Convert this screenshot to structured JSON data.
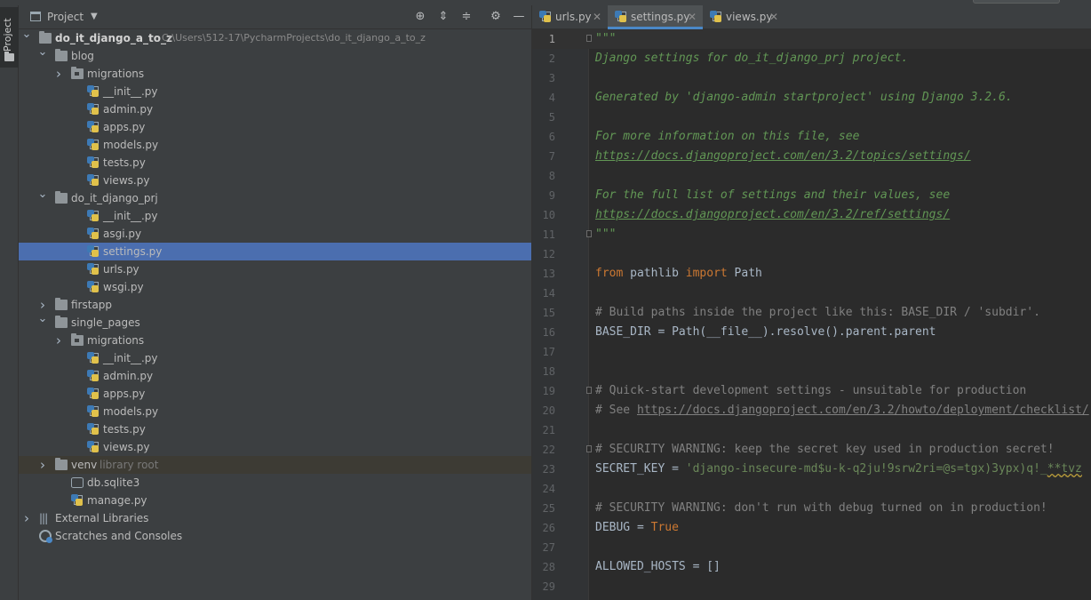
{
  "project_panel": {
    "title": "Project",
    "tool_window_label": "Project",
    "tree": [
      {
        "depth": 0,
        "type": "folder",
        "expanded": true,
        "label": "do_it_django_a_to_z",
        "bold": true,
        "path": "C:\\Users\\512-17\\PycharmProjects\\do_it_django_a_to_z"
      },
      {
        "depth": 1,
        "type": "folder",
        "expanded": true,
        "label": "blog"
      },
      {
        "depth": 2,
        "type": "package",
        "expanded": false,
        "label": "migrations"
      },
      {
        "depth": 2,
        "type": "py",
        "label": "__init__.py"
      },
      {
        "depth": 2,
        "type": "py",
        "label": "admin.py"
      },
      {
        "depth": 2,
        "type": "py",
        "label": "apps.py"
      },
      {
        "depth": 2,
        "type": "py",
        "label": "models.py"
      },
      {
        "depth": 2,
        "type": "py",
        "label": "tests.py"
      },
      {
        "depth": 2,
        "type": "py",
        "label": "views.py"
      },
      {
        "depth": 1,
        "type": "folder",
        "expanded": true,
        "label": "do_it_django_prj"
      },
      {
        "depth": 2,
        "type": "py",
        "label": "__init__.py"
      },
      {
        "depth": 2,
        "type": "py",
        "label": "asgi.py"
      },
      {
        "depth": 2,
        "type": "py",
        "label": "settings.py",
        "selected": true
      },
      {
        "depth": 2,
        "type": "py",
        "label": "urls.py"
      },
      {
        "depth": 2,
        "type": "py",
        "label": "wsgi.py"
      },
      {
        "depth": 1,
        "type": "folder",
        "expanded": false,
        "label": "firstapp"
      },
      {
        "depth": 1,
        "type": "folder",
        "expanded": true,
        "label": "single_pages"
      },
      {
        "depth": 2,
        "type": "package",
        "expanded": false,
        "label": "migrations"
      },
      {
        "depth": 2,
        "type": "py",
        "label": "__init__.py"
      },
      {
        "depth": 2,
        "type": "py",
        "label": "admin.py"
      },
      {
        "depth": 2,
        "type": "py",
        "label": "apps.py"
      },
      {
        "depth": 2,
        "type": "py",
        "label": "models.py"
      },
      {
        "depth": 2,
        "type": "py",
        "label": "tests.py"
      },
      {
        "depth": 2,
        "type": "py",
        "label": "views.py"
      },
      {
        "depth": 1,
        "type": "folder",
        "expanded": false,
        "label": "venv",
        "hint": "library root",
        "excluded": true
      },
      {
        "depth": 1,
        "type": "db",
        "label": "db.sqlite3"
      },
      {
        "depth": 1,
        "type": "py",
        "label": "manage.py"
      },
      {
        "depth": 0,
        "type": "lib",
        "expanded": false,
        "label": "External Libraries"
      },
      {
        "depth": 0,
        "type": "scratch",
        "label": "Scratches and Consoles"
      }
    ]
  },
  "editor": {
    "tabs": [
      {
        "label": "urls.py",
        "active": false
      },
      {
        "label": "settings.py",
        "active": true
      },
      {
        "label": "views.py",
        "active": false
      }
    ],
    "current_line": 1,
    "lines": [
      {
        "n": "1",
        "fold": true,
        "tokens": [
          [
            "doc",
            "\"\"\""
          ]
        ]
      },
      {
        "n": "2",
        "tokens": [
          [
            "doc",
            "Django settings for do_it_django_prj project."
          ]
        ]
      },
      {
        "n": "3",
        "tokens": []
      },
      {
        "n": "4",
        "tokens": [
          [
            "doc",
            "Generated by 'django-admin startproject' using Django 3.2.6."
          ]
        ]
      },
      {
        "n": "5",
        "tokens": []
      },
      {
        "n": "6",
        "tokens": [
          [
            "doc",
            "For more information on this file, see"
          ]
        ]
      },
      {
        "n": "7",
        "tokens": [
          [
            "doclink",
            "https://docs.djangoproject.com/en/3.2/topics/settings/"
          ]
        ]
      },
      {
        "n": "8",
        "tokens": []
      },
      {
        "n": "9",
        "tokens": [
          [
            "doc",
            "For the full list of settings and their values, see"
          ]
        ]
      },
      {
        "n": "10",
        "tokens": [
          [
            "doclink",
            "https://docs.djangoproject.com/en/3.2/ref/settings/"
          ]
        ]
      },
      {
        "n": "11",
        "fold": true,
        "tokens": [
          [
            "doc",
            "\"\"\""
          ]
        ]
      },
      {
        "n": "12",
        "tokens": []
      },
      {
        "n": "13",
        "tokens": [
          [
            "kw",
            "from"
          ],
          [
            "pl",
            " pathlib "
          ],
          [
            "kw",
            "import"
          ],
          [
            "pl",
            " Path"
          ]
        ]
      },
      {
        "n": "14",
        "tokens": []
      },
      {
        "n": "15",
        "tokens": [
          [
            "cm",
            "# Build paths inside the project like this: BASE_DIR / 'subdir'."
          ]
        ]
      },
      {
        "n": "16",
        "tokens": [
          [
            "pl",
            "BASE_DIR = Path(__file__).resolve().parent.parent"
          ]
        ]
      },
      {
        "n": "17",
        "tokens": []
      },
      {
        "n": "18",
        "tokens": []
      },
      {
        "n": "19",
        "fold": true,
        "tokens": [
          [
            "cm",
            "# Quick-start development settings - unsuitable for production"
          ]
        ]
      },
      {
        "n": "20",
        "tokens": [
          [
            "cm",
            "# See "
          ],
          [
            "cmlink",
            "https://docs.djangoproject.com/en/3.2/howto/deployment/checklist/"
          ]
        ]
      },
      {
        "n": "21",
        "tokens": []
      },
      {
        "n": "22",
        "fold": true,
        "tokens": [
          [
            "cm",
            "# SECURITY WARNING: keep the secret key used in production secret!"
          ]
        ]
      },
      {
        "n": "23",
        "tokens": [
          [
            "pl",
            "SECRET_KEY = "
          ],
          [
            "str",
            "'django-insecure-md$u-k-q2ju!9srw2ri=@s=tgx)3ypx)q!_"
          ],
          [
            "strwarn",
            "**tvz"
          ]
        ]
      },
      {
        "n": "24",
        "tokens": []
      },
      {
        "n": "25",
        "tokens": [
          [
            "cm",
            "# SECURITY WARNING: don't run with debug turned on in production!"
          ]
        ]
      },
      {
        "n": "26",
        "tokens": [
          [
            "pl",
            "DEBUG = "
          ],
          [
            "kw",
            "True"
          ]
        ]
      },
      {
        "n": "27",
        "tokens": []
      },
      {
        "n": "28",
        "tokens": [
          [
            "pl",
            "ALLOWED_HOSTS = []"
          ]
        ]
      },
      {
        "n": "29",
        "tokens": []
      }
    ]
  },
  "colors": {
    "selection": "#4b6eaf",
    "docstring": "#629755",
    "keyword": "#cc7832",
    "comment": "#808080",
    "string": "#6a8759",
    "tab_underline": "#4a88c7"
  },
  "icons": {
    "header": [
      "locate-icon",
      "expand-all-icon",
      "collapse-all-icon",
      "gear-icon",
      "hide-icon"
    ]
  }
}
